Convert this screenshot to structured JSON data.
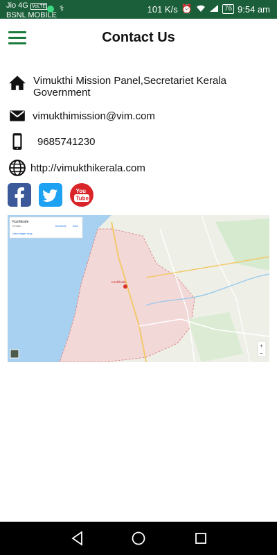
{
  "status_bar": {
    "carrier1": "Jio 4G",
    "carrier1_badge": "VoLTE",
    "carrier2": "BSNL MOBILE",
    "speed": "101 K/s",
    "battery": "76",
    "time": "9:54 am"
  },
  "app_bar": {
    "title": "Contact Us"
  },
  "contact": {
    "address_line1": "Vimukthi Mission Panel,Secretariet Kerala",
    "address_line2": "Government",
    "email": "vimukthimission@vim.com",
    "phone": "9685741230",
    "website": "http://vimukthikerala.com"
  },
  "map": {
    "place_name": "Kozhikode",
    "place_region": "Kerala",
    "view_larger": "View larger map",
    "directions": "Directions",
    "save": "Save",
    "marker_label": "Kozhikode",
    "zoom_in": "+",
    "zoom_out": "−"
  },
  "colors": {
    "status_bar": "#1b5e3a",
    "accent": "#1b7a3e",
    "facebook": "#3b5998",
    "twitter": "#1da1f2",
    "youtube": "#d9252a"
  }
}
